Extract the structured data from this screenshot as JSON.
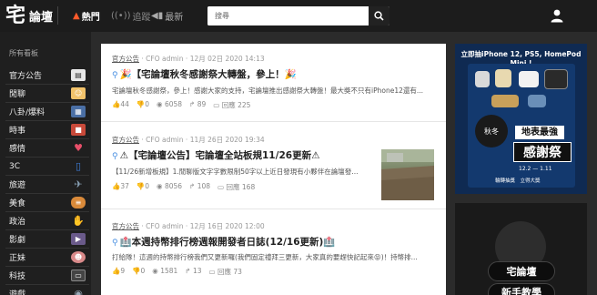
{
  "app": {
    "logo_char": "宅",
    "logo_text": "論壇"
  },
  "nav": {
    "hot": "熱門",
    "follow": "追蹤",
    "new": "最新"
  },
  "search": {
    "placeholder": "搜尋"
  },
  "sidebar": {
    "title": "所有看板",
    "items": [
      {
        "label": "官方公告",
        "color": "#e8e8e8"
      },
      {
        "label": "閒聊",
        "color": "#f2c36b"
      },
      {
        "label": "八卦/爆料",
        "color": "#4a6fa5"
      },
      {
        "label": "時事",
        "color": "#c94a3a"
      },
      {
        "label": "感情",
        "color": "#e94f6a"
      },
      {
        "label": "3C",
        "color": "#3d7dd8"
      },
      {
        "label": "旅遊",
        "color": "#8aa3b8"
      },
      {
        "label": "美食",
        "color": "#d98a3a"
      },
      {
        "label": "政治",
        "color": "#f0e6d0"
      },
      {
        "label": "影劇",
        "color": "#6a5a8a"
      },
      {
        "label": "正妹",
        "color": "#d98a8a"
      },
      {
        "label": "科技",
        "color": "#444"
      },
      {
        "label": "遊戲",
        "color": "#5a6b7a"
      }
    ]
  },
  "posts": [
    {
      "category": "官方公告",
      "author": "CFO admin",
      "date": "12月 02日 2020 14:13",
      "title": "🎉【宅論壇秋冬感謝祭大轉盤，參上！🎉",
      "excerpt": "宅論壇秋冬感謝祭，參上！感謝大家的支持，宅論壇推出感謝祭大轉盤！最大獎不只有iPhone12還有...",
      "likes": "44",
      "dislikes": "0",
      "views": "6058",
      "shares": "89",
      "replies": "回應 225"
    },
    {
      "category": "官方公告",
      "author": "CFO admin",
      "date": "11月 26日 2020 19:34",
      "title": "⚠【宅論壇公告】宅論壇全站板規11/26更新⚠",
      "excerpt": "【11/26新增板規】1.閒聊版文字字數限制50字以上近日發現有小夥伴在論壇發...",
      "likes": "37",
      "dislikes": "0",
      "views": "8056",
      "shares": "108",
      "replies": "回應 168"
    },
    {
      "category": "官方公告",
      "author": "CFO admin",
      "date": "12月 16日 2020 12:00",
      "title": "🏥本週持幣排行榜週報開發者日誌(12/16更新)🏥",
      "excerpt": "打給隊！這週的持幣排行榜我們又更新囉(我們固定禮拜三更新，大家真的要趕快記起來😝)！持幣排...",
      "likes": "9",
      "dislikes": "0",
      "views": "1581",
      "shares": "13",
      "replies": "回應 73"
    }
  ],
  "ads": {
    "top": {
      "headline": "立即抽iPhone 12, PS5, HomePod Mini !",
      "seal": "秋冬",
      "line1": "地表最強",
      "line2": "感謝祭",
      "date": "12.2 — 1.11",
      "footer": "輪轉抽獎　立得大獎"
    },
    "bottom": {
      "line1": "宅論壇",
      "line2": "新手教學"
    }
  }
}
